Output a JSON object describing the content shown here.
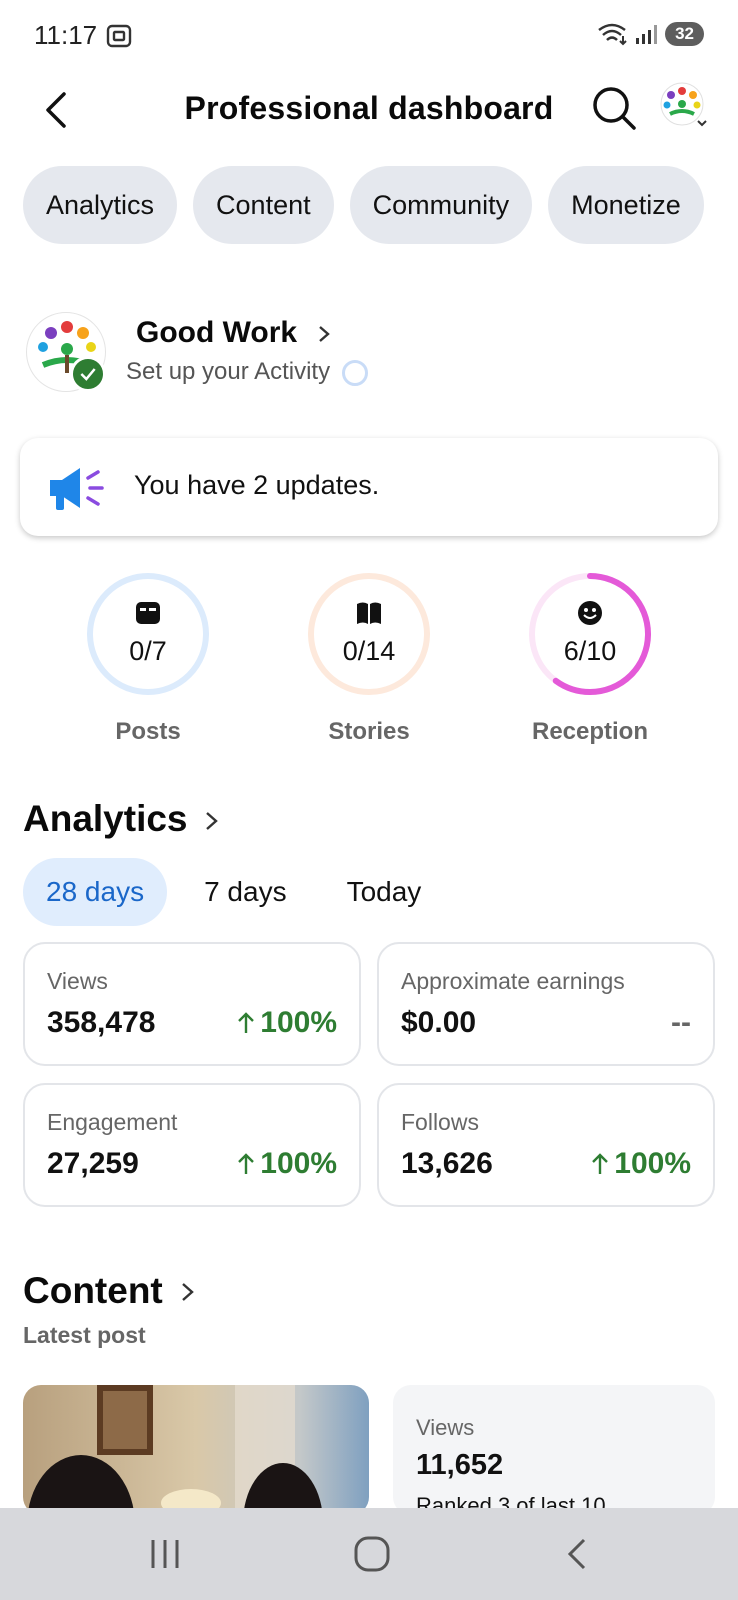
{
  "status_bar": {
    "time": "11:17",
    "battery": "32",
    "icons": [
      "screenshot-icon",
      "wifi-icon",
      "signal-icon",
      "battery-icon"
    ]
  },
  "header": {
    "title": "Professional dashboard",
    "icons": [
      "back-arrow-icon",
      "search-icon",
      "avatar-dropdown"
    ]
  },
  "tabs": [
    "Analytics",
    "Content",
    "Community",
    "Monetize"
  ],
  "profile": {
    "name": "Good Work",
    "subtitle": "Set up your Activity"
  },
  "updates": {
    "text": "You have 2 updates."
  },
  "goals": [
    {
      "label": "Posts",
      "value": "0/7",
      "progress": 0.0,
      "color": "#dcebfc",
      "accent": "#dcebfc",
      "icon": "posts-icon"
    },
    {
      "label": "Stories",
      "value": "0/14",
      "progress": 0.0,
      "color": "#fde9dc",
      "accent": "#fde9dc",
      "icon": "book-icon"
    },
    {
      "label": "Reception",
      "value": "6/10",
      "progress": 0.6,
      "color": "#fbe6f7",
      "accent": "#e45ad8",
      "icon": "smiley-icon"
    }
  ],
  "analytics": {
    "title": "Analytics",
    "ranges": [
      "28 days",
      "7 days",
      "Today"
    ],
    "selected_range": "28 days",
    "metrics": [
      {
        "label": "Views",
        "value": "358,478",
        "change": "100%",
        "trend": "up"
      },
      {
        "label": "Approximate earnings",
        "value": "$0.00",
        "change": "--",
        "trend": "none"
      },
      {
        "label": "Engagement",
        "value": "27,259",
        "change": "100%",
        "trend": "up"
      },
      {
        "label": "Follows",
        "value": "13,626",
        "change": "100%",
        "trend": "up"
      }
    ]
  },
  "content": {
    "title": "Content",
    "subtitle": "Latest post",
    "latest_post": {
      "views_label": "Views",
      "views_value": "11,652",
      "rank_text": "Ranked 3 of last 10"
    }
  },
  "colors": {
    "accent_blue": "#1a67c9",
    "positive_green": "#2e7d32",
    "chip_bg": "#e5e8ee"
  }
}
